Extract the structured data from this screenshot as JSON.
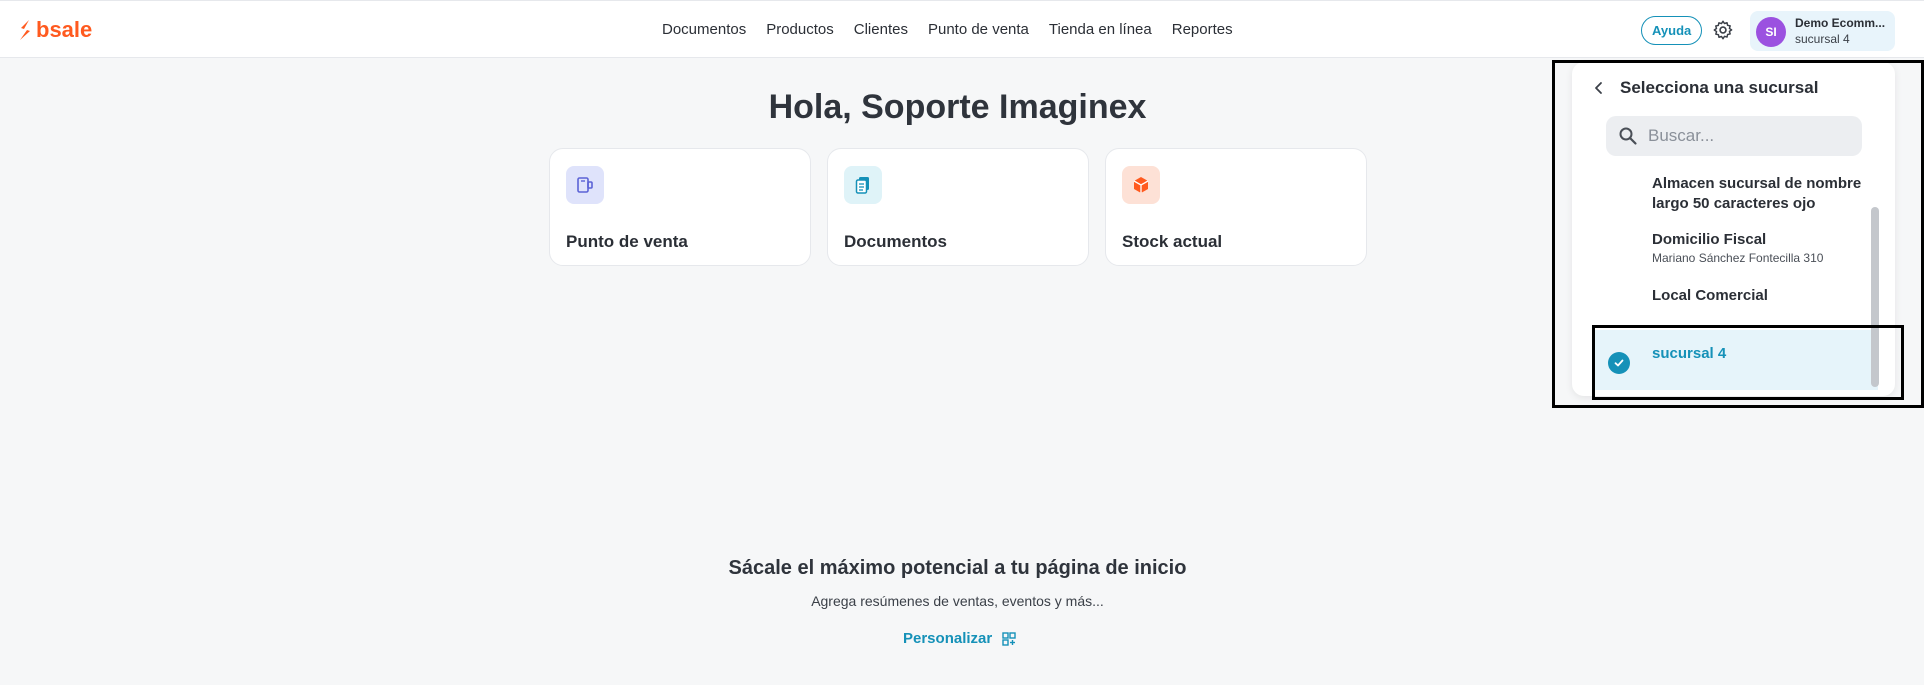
{
  "header": {
    "logo_text": "bsale",
    "nav": [
      "Documentos",
      "Productos",
      "Clientes",
      "Punto de venta",
      "Tienda en línea",
      "Reportes"
    ],
    "help_label": "Ayuda",
    "account": {
      "initials": "SI",
      "name": "Demo Ecomm...",
      "branch": "sucursal 4"
    }
  },
  "main": {
    "greeting": "Hola, Soporte Imaginex",
    "cards": [
      {
        "label": "Punto de venta"
      },
      {
        "label": "Documentos"
      },
      {
        "label": "Stock actual"
      }
    ],
    "promo": {
      "title": "Sácale el máximo potencial a tu página de inicio",
      "subtitle": "Agrega resúmenes de ventas, eventos y más...",
      "link_label": "Personalizar"
    }
  },
  "branch_panel": {
    "title": "Selecciona una sucursal",
    "search_placeholder": "Buscar...",
    "items": [
      {
        "title": "Almacen sucursal de nombre largo 50 caracteres ojo",
        "subtitle": ""
      },
      {
        "title": "Domicilio Fiscal",
        "subtitle": "Mariano Sánchez Fontecilla 310"
      },
      {
        "title": "Local Comercial",
        "subtitle": ""
      },
      {
        "title": "sucursal 4",
        "subtitle": "",
        "selected": true
      }
    ]
  },
  "colors": {
    "brand": "#ff5a1f",
    "accent": "#1591b8",
    "avatar": "#9b51e0"
  }
}
